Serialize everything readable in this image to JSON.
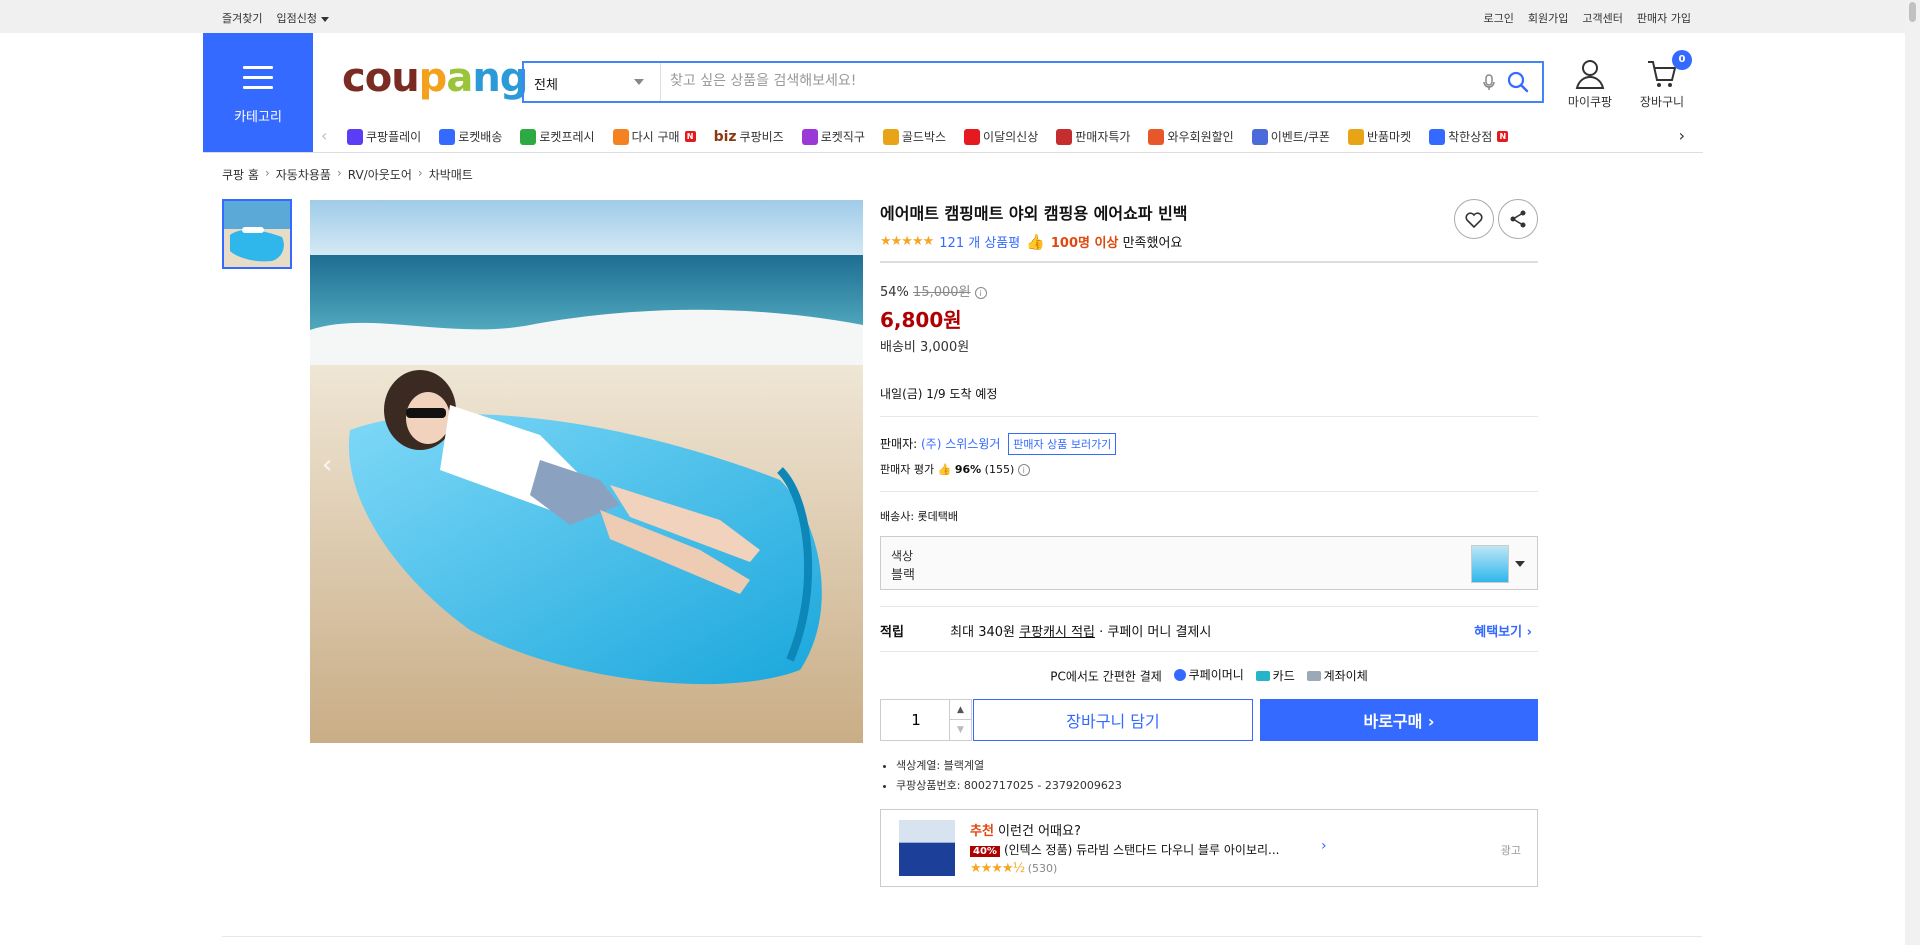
{
  "topbar": {
    "left": [
      "즐겨찾기",
      "입점신청"
    ],
    "right": [
      "로그인",
      "회원가입",
      "고객센터",
      "판매자 가입"
    ]
  },
  "header": {
    "category_label": "카테고리",
    "logo": [
      "cou",
      "p",
      "a",
      "n",
      "g"
    ],
    "search_category": "전체",
    "search_placeholder": "찾고 싶은 상품을 검색해보세요!",
    "my_coupang": "마이쿠팡",
    "cart": "장바구니",
    "cart_count": "0"
  },
  "nav": [
    {
      "label": "쿠팡플레이",
      "icon": "play-icon",
      "color": "#5b3df5"
    },
    {
      "label": "로켓배송",
      "icon": "rocket-icon",
      "color": "#346aff"
    },
    {
      "label": "로켓프레시",
      "icon": "rocket-fresh-icon",
      "color": "#2eaa42"
    },
    {
      "label": "다시 구매",
      "icon": "rebuy-icon",
      "color": "#f58220",
      "badge": "N"
    },
    {
      "label": "쿠팡비즈",
      "prefix": "biz",
      "icon": "biz-icon",
      "color": "#8a3a12"
    },
    {
      "label": "로켓직구",
      "icon": "rocket-global-icon",
      "color": "#9a38d8"
    },
    {
      "label": "골드박스",
      "icon": "goldbox-icon",
      "color": "#e8a317"
    },
    {
      "label": "이달의신상",
      "icon": "new-icon",
      "color": "#e5191e"
    },
    {
      "label": "판매자특가",
      "icon": "seller-deal-icon",
      "color": "#c42e2e"
    },
    {
      "label": "와우회원할인",
      "icon": "wow-icon",
      "color": "#e8572a"
    },
    {
      "label": "이벤트/쿠폰",
      "icon": "coupon-icon",
      "color": "#4a6bd8"
    },
    {
      "label": "반품마켓",
      "icon": "return-market-icon",
      "color": "#e8a317"
    },
    {
      "label": "착한상점",
      "icon": "good-store-icon",
      "color": "#346aff",
      "badge": "N"
    }
  ],
  "breadcrumb": [
    "쿠팡 홈",
    "자동차용품",
    "RV/아웃도어",
    "차박매트"
  ],
  "product": {
    "title": "에어매트 캠핑매트 야외 캠핑용 에어쇼파 빈백",
    "rating_stars": "★★★★★",
    "rating_value": 4.5,
    "review_count": "121 개 상품평",
    "satisfaction_bold": "100명 이상",
    "satisfaction_rest": " 만족했어요",
    "discount_rate": "54%",
    "original_price": "15,000원",
    "price": "6,800원",
    "shipping_fee": "배송비 3,000원",
    "arrival": "내일(금) 1/9 도착 예정",
    "seller_label": "판매자: ",
    "seller_name": "(주) 스위스윙거",
    "seller_button": "판매자 상품 보러가기",
    "seller_rating_label": "판매자 평가",
    "seller_rating_value": "96%",
    "seller_rating_count": "(155)",
    "carrier": "배송사:  롯데택배",
    "option_label": "색상",
    "option_value": "블랙",
    "reward_key": "적립",
    "reward_text1": "최대 340원 ",
    "reward_link": "쿠팡캐시 적립",
    "reward_text2": " · 쿠페이 머니 결제시",
    "reward_more": "혜택보기 ›",
    "pc_pay": "PC에서도 간편한 결제",
    "pay_methods": [
      "쿠페이머니",
      "카드",
      "계좌이체"
    ],
    "quantity": "1",
    "add_to_cart": "장바구니 담기",
    "buy_now": "바로구매 ›",
    "specs": [
      "색상계열: 블랙계열",
      "쿠팡상품번호: 8002717025 - 23792009623"
    ]
  },
  "recommend": {
    "heading_accent": "추천",
    "heading_rest": " 이런건 어때요?",
    "discount": "40%",
    "name": "(인텍스 정품) 듀라빔 스탠다드 다우니 블루 아이보리...",
    "stars": "★★★★½",
    "rating_value": 4.5,
    "reviews": "(530)",
    "ad": "광고"
  },
  "colors": {
    "accent": "#346aff",
    "price": "#ae0000",
    "satisfaction": "#e0480e"
  }
}
